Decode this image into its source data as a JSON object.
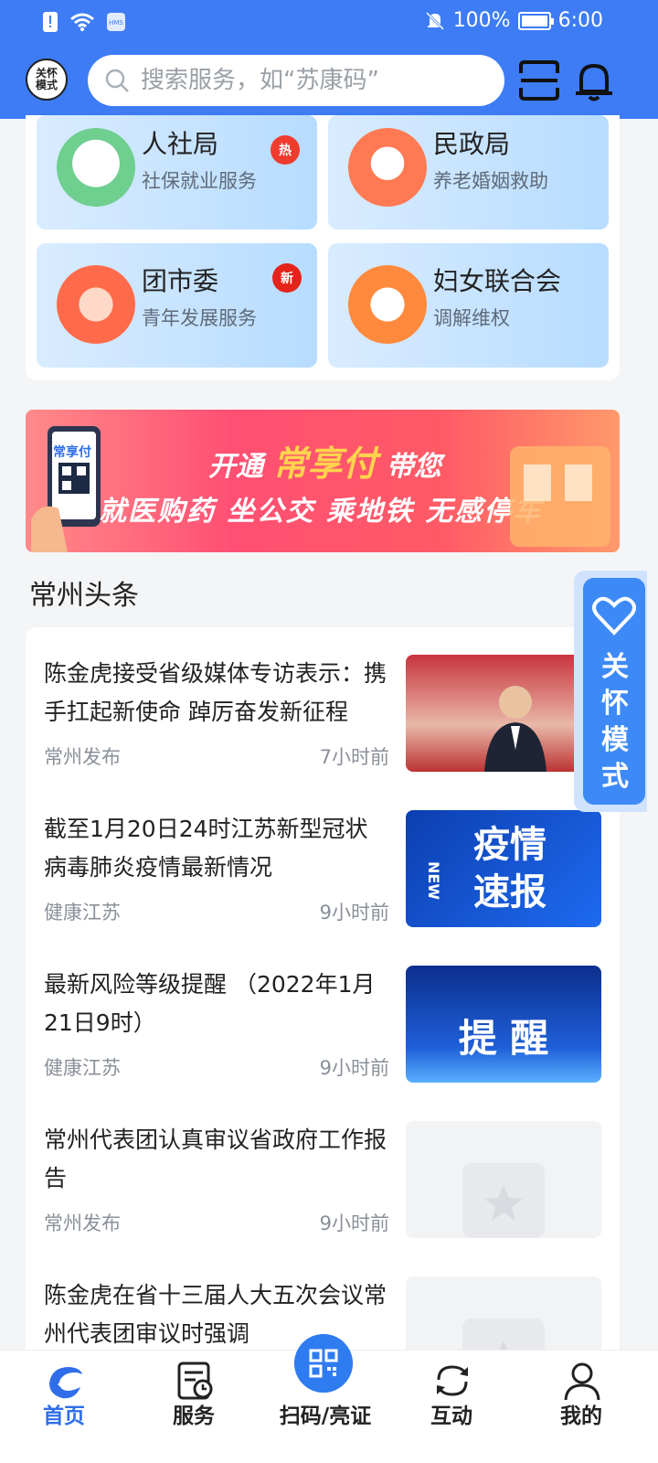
{
  "status": {
    "battery": "100%",
    "time": "6:00"
  },
  "header": {
    "care_badge": "关怀模式",
    "search_placeholder": "搜索服务，如“苏康码”"
  },
  "services": [
    {
      "title": "人社局",
      "subtitle": "社保就业服务",
      "badge": "热"
    },
    {
      "title": "民政局",
      "subtitle": "养老婚姻救助",
      "badge": ""
    },
    {
      "title": "团市委",
      "subtitle": "青年发展服务",
      "badge": "新"
    },
    {
      "title": "妇女联合会",
      "subtitle": "调解维权",
      "badge": ""
    }
  ],
  "banner": {
    "line1_prefix": "开通",
    "line1_highlight": "常享付",
    "line1_suffix": "带您",
    "line2": "就医购药 坐公交 乘地铁 无感停车",
    "phone_label": "常享付"
  },
  "section": {
    "title": "常州头条"
  },
  "news": [
    {
      "title": "陈金虎接受省级媒体专访表示：携手扛起新使命 踔厉奋发新征程",
      "source": "常州发布",
      "time": "7小时前"
    },
    {
      "title": "截至1月20日24时江苏新型冠状病毒肺炎疫情最新情况",
      "source": "健康江苏",
      "time": "9小时前",
      "img_text": "疫情速报",
      "img_tag": "NEW"
    },
    {
      "title": "最新风险等级提醒 （2022年1月21日9时）",
      "source": "健康江苏",
      "time": "9小时前",
      "img_text": "提 醒"
    },
    {
      "title": "常州代表团认真审议省政府工作报告",
      "source": "常州发布",
      "time": "9小时前"
    },
    {
      "title": "陈金虎在省十三届人大五次会议常州代表团审议时强调",
      "source": "",
      "time": ""
    }
  ],
  "side_care": {
    "label": "关怀模式"
  },
  "bottom_nav": [
    {
      "label": "首页"
    },
    {
      "label": "服务"
    },
    {
      "label": "扫码/亮证"
    },
    {
      "label": "互动"
    },
    {
      "label": "我的"
    }
  ]
}
